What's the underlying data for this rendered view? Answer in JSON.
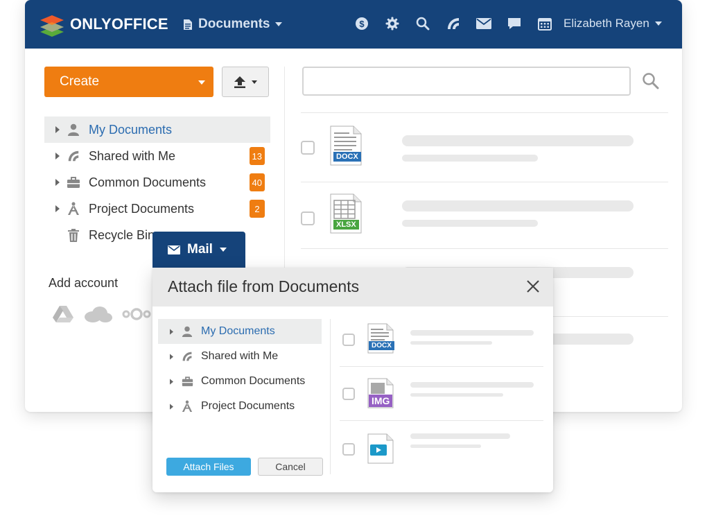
{
  "colors": {
    "topbar": "#15437a",
    "accent_orange": "#ef7d11",
    "selected_link": "#2b6cb0",
    "attach_blue": "#3da9e0",
    "docx_blue": "#2a71b6",
    "xlsx_green": "#49a540",
    "img_purple": "#9660c4",
    "video_teal": "#1c99c9"
  },
  "header": {
    "logo_text": "ONLYOFFICE",
    "module": "Documents",
    "icons": [
      "payment-icon",
      "settings-icon",
      "search-icon",
      "feed-icon",
      "mail-icon",
      "chat-icon",
      "calendar-icon"
    ],
    "user": "Elizabeth Rayen"
  },
  "toolbar": {
    "create_label": "Create"
  },
  "sidebar": {
    "items": [
      {
        "label": "My Documents",
        "icon": "user-icon",
        "selected": true
      },
      {
        "label": "Shared with Me",
        "icon": "shared-icon",
        "badge": "13"
      },
      {
        "label": "Common Documents",
        "icon": "briefcase-icon",
        "badge": "40"
      },
      {
        "label": "Project Documents",
        "icon": "project-icon",
        "badge": "2"
      },
      {
        "label": "Recycle Bin",
        "icon": "trash-icon"
      }
    ],
    "add_account": "Add account",
    "accounts": [
      "google-drive-icon",
      "onedrive-icon",
      "nextcloud-icon"
    ]
  },
  "files": [
    {
      "type": "DOCX"
    },
    {
      "type": "XLSX"
    }
  ],
  "mail_tab": {
    "label": "Mail"
  },
  "dialog": {
    "title": "Attach file from Documents",
    "tree": [
      {
        "label": "My Documents",
        "selected": true
      },
      {
        "label": "Shared with Me"
      },
      {
        "label": "Common Documents"
      },
      {
        "label": "Project Documents"
      }
    ],
    "files": [
      {
        "type": "DOCX"
      },
      {
        "type": "IMG"
      },
      {
        "type": "video"
      }
    ],
    "attach_label": "Attach Files",
    "cancel_label": "Cancel"
  }
}
